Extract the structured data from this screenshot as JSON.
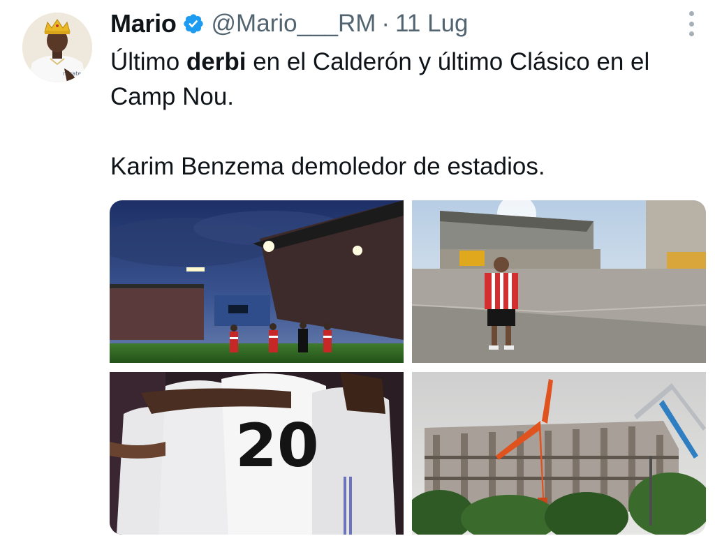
{
  "tweet": {
    "author": {
      "name": "Mario",
      "handle": "@Mario___RM",
      "separator": "·",
      "date": "11 Lug",
      "avatar_icon": "avatar-crowned-player",
      "verified_icon": "verified-badge-icon",
      "verified_color": "#1d9bf0"
    },
    "text": {
      "line1_pre": "Último ",
      "line1_bold": "derbi",
      "line1_post": " en el Calderón y último Clásico en el Camp Nou.",
      "line2": "Karim Benzema demoledor de estadios."
    },
    "more_icon": "more-options-icon",
    "media": [
      {
        "description_icon": "stadium-night-match-photo"
      },
      {
        "description_icon": "fan-empty-demolished-stadium-photo"
      },
      {
        "description_icon": "players-celebrating-number-20-photo",
        "shirt_number": "20"
      },
      {
        "description_icon": "stadium-demolition-cranes-photo"
      }
    ],
    "colors": {
      "text": "#0f1419",
      "secondary": "#536471",
      "accent": "#1d9bf0"
    }
  }
}
